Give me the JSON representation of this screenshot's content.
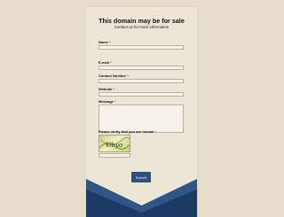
{
  "page": {
    "title": "This domain may be for sale",
    "subtitle": "Contact us for more information"
  },
  "form": {
    "fields": [
      {
        "label": "Name",
        "required": "*",
        "value": ""
      },
      {
        "label": "E-mail",
        "required": "*",
        "value": ""
      },
      {
        "label": "Contact Number",
        "required": "*",
        "value": ""
      },
      {
        "label": "Website",
        "required": "*",
        "value": ""
      },
      {
        "label": "Message",
        "required": "*",
        "value": ""
      }
    ],
    "captcha": {
      "label": "Please verify that you are human",
      "required": "*",
      "image_text": "kibyo",
      "value": ""
    },
    "submit_label": "Submit"
  },
  "colors": {
    "background": "#e6dccb",
    "envelope": "#ede5d6",
    "flap_dark": "#1c3a63",
    "flap_light": "#2f5687",
    "button": "#2f4f7f",
    "required": "#c0392b"
  }
}
